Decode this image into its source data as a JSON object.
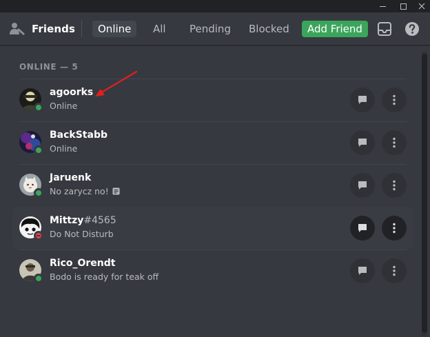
{
  "header": {
    "title": "Friends",
    "tabs": [
      {
        "label": "Online",
        "active": true
      },
      {
        "label": "All"
      },
      {
        "label": "Pending"
      },
      {
        "label": "Blocked"
      }
    ],
    "add_friend_label": "Add Friend",
    "inbox_icon": "inbox-icon",
    "help_icon": "help-icon"
  },
  "section_title": "ONLINE — 5",
  "friends": [
    {
      "name": "agoorks",
      "discriminator": "",
      "status_text": "Online",
      "status": "online"
    },
    {
      "name": "BackStabb",
      "discriminator": "",
      "status_text": "Online",
      "status": "online"
    },
    {
      "name": "Jaruenk",
      "discriminator": "",
      "status_text": "No zarycz no!",
      "status": "online",
      "has_note_icon": true
    },
    {
      "name": "Mittzy",
      "discriminator": "#4565",
      "status_text": "Do Not Disturb",
      "status": "dnd"
    },
    {
      "name": "Rico_Orendt",
      "discriminator": "",
      "status_text": "Bodo is ready for teak off",
      "status": "online"
    }
  ],
  "colors": {
    "background": "#36393f",
    "titlebar": "#202225",
    "accent_green": "#3ba55c",
    "dnd_red": "#ed4245",
    "annotation_arrow": "#e02020"
  }
}
